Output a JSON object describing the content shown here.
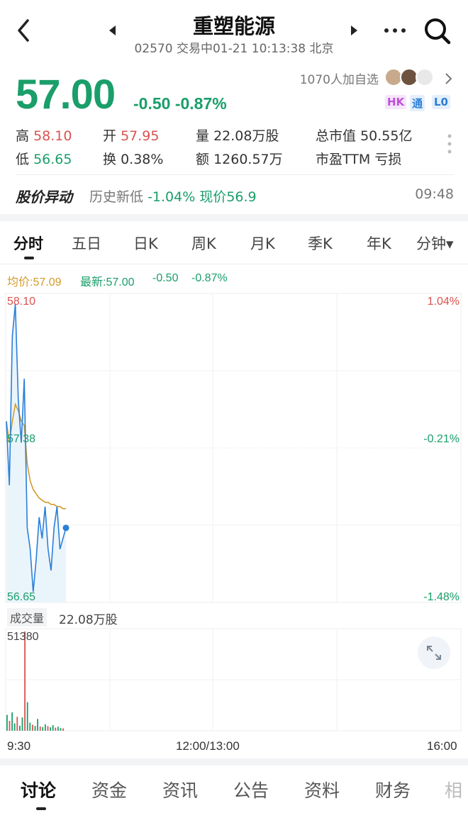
{
  "header": {
    "title": "重塑能源",
    "code": "02570",
    "status": "交易中01-21 10:13:38 北京"
  },
  "quote": {
    "price": "57.00",
    "change": "-0.50",
    "change_pct": "-0.87%",
    "followers": "1070人加自选",
    "badges": [
      "HK",
      "通",
      "L0"
    ],
    "colors": {
      "down": "#1a9e6a",
      "up": "#d9534f",
      "avg": "#d49a2a",
      "accent": "#2b7fd8"
    }
  },
  "stats": {
    "high_label": "高",
    "high": "58.10",
    "open_label": "开",
    "open": "57.95",
    "volume_label": "量",
    "volume": "22.08万股",
    "mcap_label": "总市值",
    "mcap": "50.55亿",
    "low_label": "低",
    "low": "56.65",
    "turnover_label": "换",
    "turnover": "0.38%",
    "amount_label": "额",
    "amount": "1260.57万",
    "pe_label": "市盈TTM",
    "pe": "亏损"
  },
  "alert": {
    "title": "股价异动",
    "text": "历史新低",
    "pct": "-1.04%",
    "now": "现价56.9",
    "time": "09:48"
  },
  "tabs": [
    "分时",
    "五日",
    "日K",
    "周K",
    "月K",
    "季K",
    "年K",
    "分钟▾"
  ],
  "legend": {
    "avg": "均价:57.09",
    "latest": "最新:57.00",
    "chg": "-0.50",
    "pct": "-0.87%"
  },
  "axis": {
    "y_top": "58.10",
    "y_mid": "57.38",
    "y_bot": "56.65",
    "r_top": "1.04%",
    "r_mid": "-0.21%",
    "r_bot": "-1.48%",
    "x_start": "9:30",
    "x_mid": "12:00/13:00",
    "x_end": "16:00"
  },
  "volume": {
    "label": "成交量",
    "total": "22.08万股",
    "max": "51380"
  },
  "chart_data": [
    {
      "type": "line",
      "title": "",
      "ylim": [
        56.65,
        58.1
      ],
      "y_ticks": [
        "58.10",
        "57.38",
        "56.65"
      ],
      "x_ticks": [
        "9:30",
        "12:00/13:00",
        "16:00"
      ],
      "series": [
        {
          "name": "最新",
          "values": [
            57.5,
            57.2,
            57.9,
            58.05,
            57.6,
            57.4,
            57.7,
            57.0,
            56.9,
            56.7,
            56.85,
            57.05,
            56.95,
            57.1,
            56.9,
            56.8,
            57.0,
            57.1,
            56.9,
            56.95,
            57.0
          ]
        },
        {
          "name": "均价",
          "values": [
            57.5,
            57.4,
            57.5,
            57.58,
            57.55,
            57.5,
            57.48,
            57.3,
            57.22,
            57.18,
            57.16,
            57.14,
            57.13,
            57.12,
            57.12,
            57.11,
            57.11,
            57.1,
            57.1,
            57.09,
            57.09
          ]
        }
      ]
    },
    {
      "type": "bar",
      "title": "成交量",
      "ylim": [
        0,
        51380
      ],
      "values": [
        8200,
        5100,
        9500,
        3800,
        7200,
        2600,
        6900,
        51380,
        14800,
        4200,
        3100,
        2500,
        6100,
        2200,
        1900,
        3300,
        2400,
        1800,
        2900,
        1600,
        2100,
        1400,
        1200
      ]
    }
  ]
}
